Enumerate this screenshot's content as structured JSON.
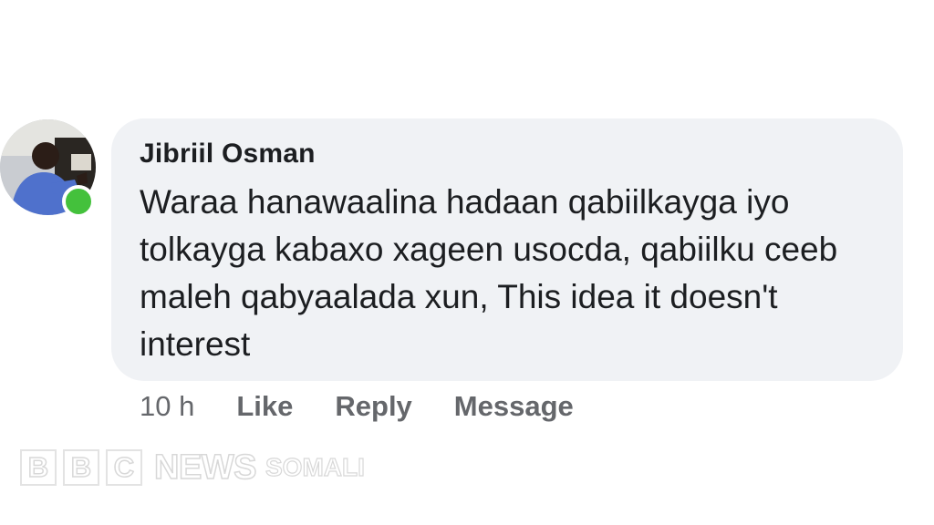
{
  "comment": {
    "author": "Jibriil Osman",
    "text": "Waraa hanawaalina hadaan qabiilkayga iyo tolkayga kabaxo xageen usocda, qabiilku ceeb maleh qabyaalada xun, This idea it doesn't interest",
    "avatar_icon": "user-avatar-photo",
    "online_status": "online"
  },
  "actions": {
    "timestamp": "10 h",
    "like_label": "Like",
    "reply_label": "Reply",
    "message_label": "Message"
  },
  "watermark": {
    "b1": "B",
    "b2": "B",
    "c": "C",
    "news": "NEWS",
    "service": "SOMALI"
  },
  "colors": {
    "bubble_bg": "#f0f2f5",
    "online": "#44c13c",
    "text": "#1c1e21",
    "meta": "#65676b"
  }
}
